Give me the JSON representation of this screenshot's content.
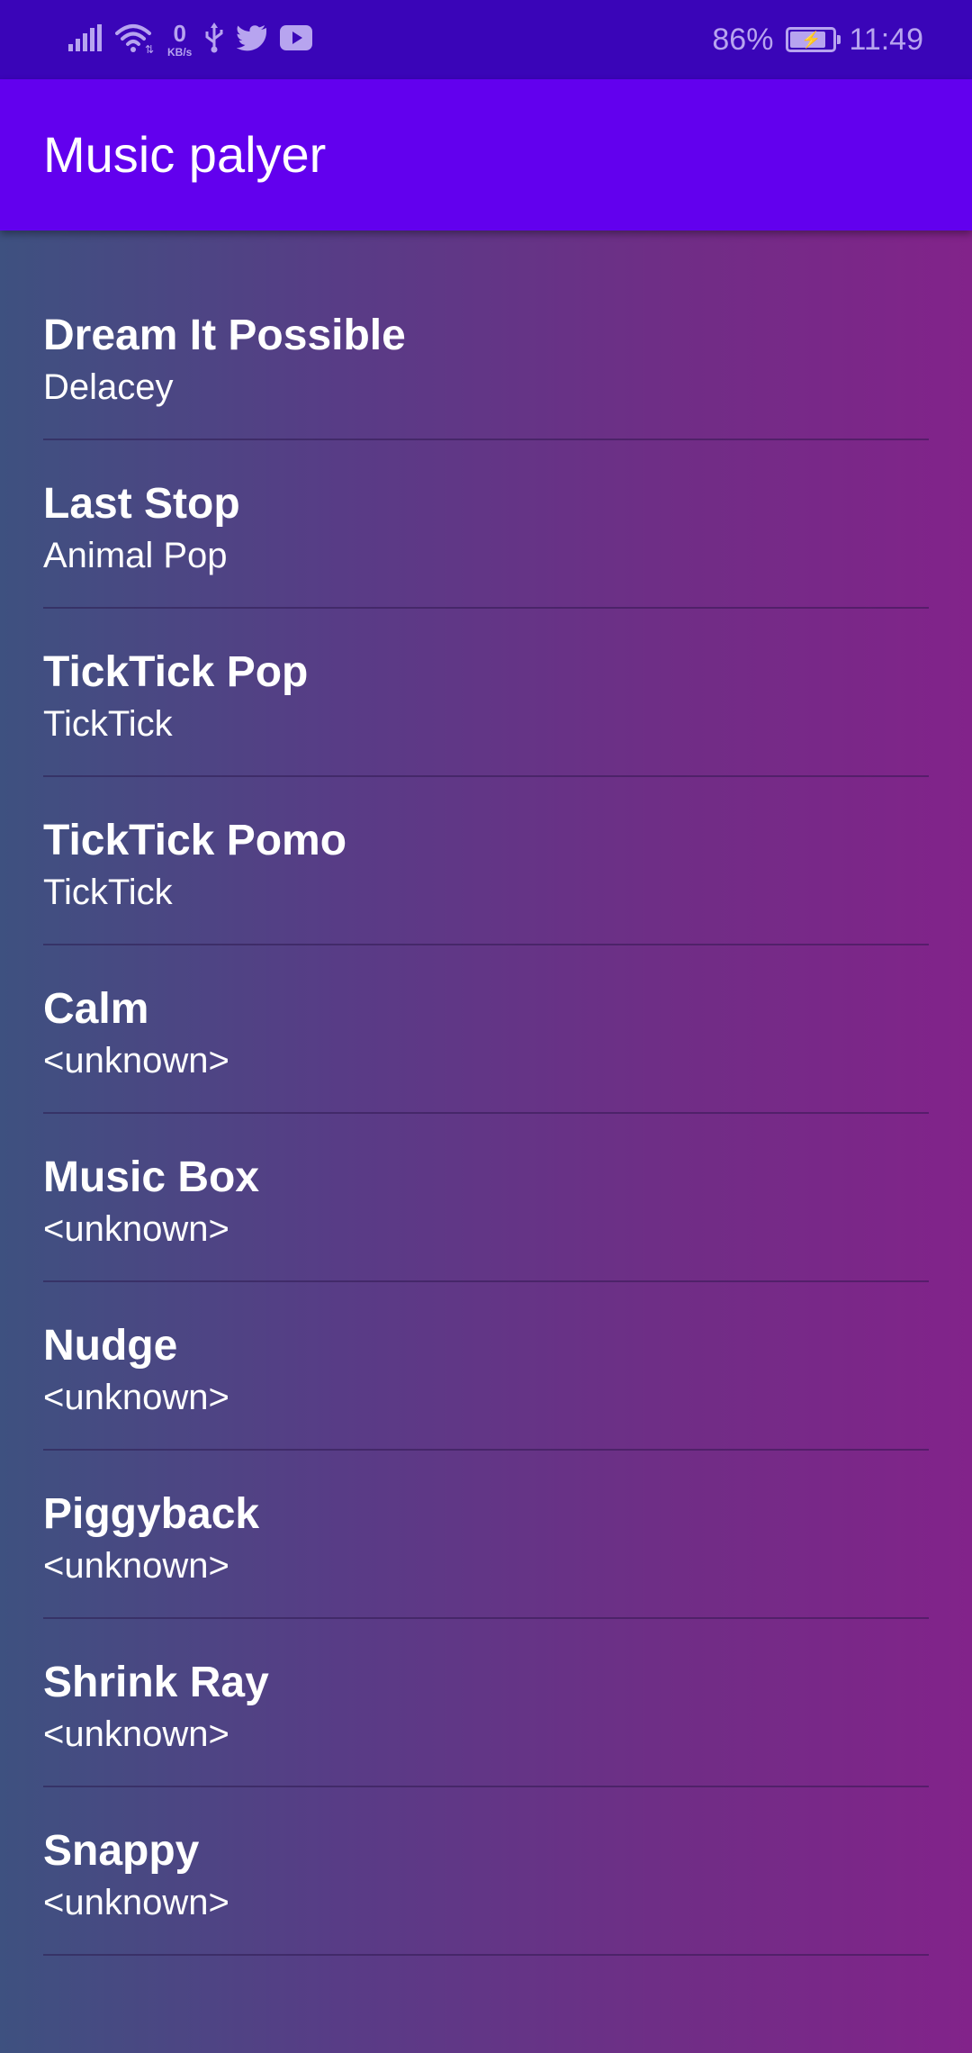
{
  "status_bar": {
    "speed_value": "0",
    "speed_unit": "KB/s",
    "battery_percent": "86%",
    "battery_level": 0.86,
    "time": "11:49",
    "icons": [
      "signal-icon",
      "wifi-icon",
      "usb-icon",
      "twitter-icon",
      "youtube-icon",
      "battery-icon"
    ]
  },
  "app_bar": {
    "title": "Music palyer",
    "color": "#6200ee"
  },
  "songs": [
    {
      "title": "Dream It Possible",
      "artist": "Delacey"
    },
    {
      "title": "Last Stop",
      "artist": "Animal Pop"
    },
    {
      "title": "TickTick Pop",
      "artist": "TickTick"
    },
    {
      "title": "TickTick Pomo",
      "artist": "TickTick"
    },
    {
      "title": "Calm",
      "artist": "<unknown>"
    },
    {
      "title": "Music Box",
      "artist": "<unknown>"
    },
    {
      "title": "Nudge",
      "artist": "<unknown>"
    },
    {
      "title": "Piggyback",
      "artist": "<unknown>"
    },
    {
      "title": "Shrink Ray",
      "artist": "<unknown>"
    },
    {
      "title": "Snappy",
      "artist": "<unknown>"
    }
  ]
}
